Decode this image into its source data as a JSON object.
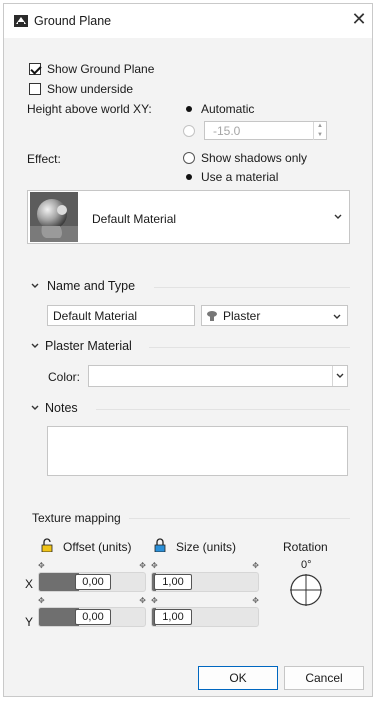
{
  "window": {
    "title": "Ground Plane",
    "close_symbol": "✕"
  },
  "options": {
    "show_ground_plane": {
      "label": "Show Ground Plane",
      "checked": true
    },
    "show_underside": {
      "label": "Show underside",
      "checked": false
    }
  },
  "height": {
    "label": "Height above world XY:",
    "automatic_label": "Automatic",
    "automatic_selected": true,
    "value": "-15.0"
  },
  "effect": {
    "label": "Effect:",
    "shadows_only_label": "Show shadows only",
    "use_material_label": "Use a material",
    "use_material_selected": true
  },
  "material": {
    "selected": "Default Material"
  },
  "name_and_type": {
    "header": "Name and Type",
    "name_value": "Default Material",
    "type_value": "Plaster"
  },
  "plaster": {
    "header": "Plaster Material",
    "color_label": "Color:"
  },
  "notes": {
    "header": "Notes",
    "value": ""
  },
  "texture": {
    "header": "Texture mapping",
    "offset_label": "Offset (units)",
    "size_label": "Size (units)",
    "rotation_label": "Rotation",
    "rotation_value": "0°",
    "x_label": "X",
    "y_label": "Y",
    "offset_x": "0,00",
    "offset_y": "0,00",
    "size_x": "1,00",
    "size_y": "1,00"
  },
  "buttons": {
    "ok": "OK",
    "cancel": "Cancel"
  },
  "colors": {
    "accent": "#0067c0",
    "window_bg": "#f3f3f3",
    "lock_open": "#f0c419",
    "lock_closed": "#2a8fd8"
  }
}
